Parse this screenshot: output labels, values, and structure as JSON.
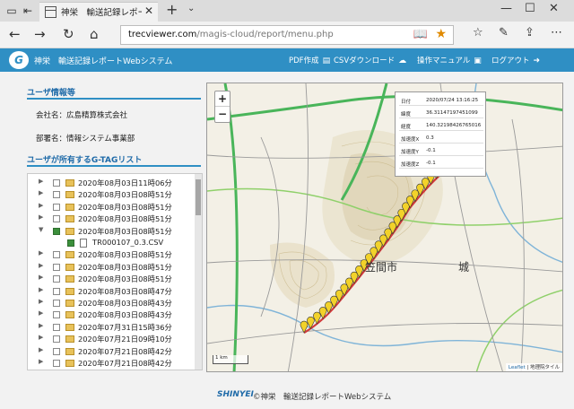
{
  "browser": {
    "tab_title": "神栄　輸送記録レポートWe",
    "url_host": "trecviewer.com",
    "url_path": "/magis-cloud/report/menu.php"
  },
  "header": {
    "logo_text": "G",
    "title": "神栄　輸送記録レポートWebシステム",
    "menu": {
      "pdf": "PDF作成",
      "csv": "CSVダウンロード",
      "manual": "操作マニュアル",
      "logout": "ログアウト"
    }
  },
  "sidebar": {
    "user_info_heading": "ユーザ情報等",
    "company": "会社名：広島精算株式会社",
    "department": "部署名：情報システム事業部",
    "gtag_heading": "ユーザが所有するG-TAGリスト",
    "tree": [
      {
        "label": "2020年08月03日11時06分",
        "type": "folder",
        "toggle": "▶",
        "checked": false
      },
      {
        "label": "2020年08月03日08時51分",
        "type": "folder",
        "toggle": "▶",
        "checked": false
      },
      {
        "label": "2020年08月03日08時51分",
        "type": "folder",
        "toggle": "▶",
        "checked": false
      },
      {
        "label": "2020年08月03日08時51分",
        "type": "folder",
        "toggle": "▶",
        "checked": false
      },
      {
        "label": "2020年08月03日08時51分",
        "type": "folder",
        "toggle": "▼",
        "checked": true
      },
      {
        "label": "TR000107_0.3.CSV",
        "type": "file",
        "toggle": "",
        "checked": true
      },
      {
        "label": "2020年08月03日08時51分",
        "type": "folder",
        "toggle": "▶",
        "checked": false
      },
      {
        "label": "2020年08月03日08時51分",
        "type": "folder",
        "toggle": "▶",
        "checked": false
      },
      {
        "label": "2020年08月03日08時51分",
        "type": "folder",
        "toggle": "▶",
        "checked": false
      },
      {
        "label": "2020年08月03日08時47分",
        "type": "folder",
        "toggle": "▶",
        "checked": false
      },
      {
        "label": "2020年08月03日08時43分",
        "type": "folder",
        "toggle": "▶",
        "checked": false
      },
      {
        "label": "2020年08月03日08時43分",
        "type": "folder",
        "toggle": "▶",
        "checked": false
      },
      {
        "label": "2020年07月31日15時36分",
        "type": "folder",
        "toggle": "▶",
        "checked": false
      },
      {
        "label": "2020年07月21日09時10分",
        "type": "folder",
        "toggle": "▶",
        "checked": false
      },
      {
        "label": "2020年07月21日08時42分",
        "type": "folder",
        "toggle": "▶",
        "checked": false
      },
      {
        "label": "2020年07月21日08時42分",
        "type": "folder",
        "toggle": "▶",
        "checked": false
      }
    ]
  },
  "map": {
    "zoom_in": "+",
    "zoom_out": "−",
    "popup": [
      {
        "key": "日付",
        "value": "2020/07/24 13:16:25"
      },
      {
        "key": "緯度",
        "value": "36.31147197451099"
      },
      {
        "key": "経度",
        "value": "140.32198426765016"
      },
      {
        "key": "加速度X",
        "value": "0.3"
      },
      {
        "key": "加速度Y",
        "value": "-0.1"
      },
      {
        "key": "加速度Z",
        "value": "-0.1"
      }
    ],
    "marker_count": 28,
    "label_1": "笠間市",
    "label_2": "城",
    "scale": "1 km",
    "attribution_link": "Leaflet",
    "attribution_text": "地理院タイル"
  },
  "footer": {
    "logo": "SHINYEI",
    "text": "©神栄　輸送記録レポートWebシステム"
  },
  "colors": {
    "header_blue": "#2f8fc4",
    "heading_blue": "#1e6aa8",
    "star": "#e08a00",
    "marker_yellow": "#f2d22a",
    "route_red": "#d23a3a"
  }
}
